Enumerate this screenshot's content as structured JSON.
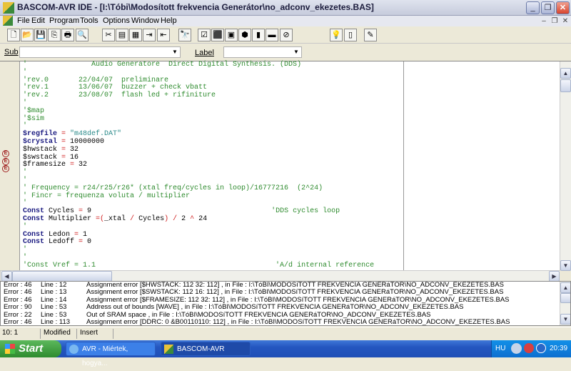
{
  "window": {
    "title": "BASCOM-AVR IDE - [I:\\Tóbi\\Modosított frekvencia Generátor\\no_adconv_ekezetes.BAS]",
    "minimize": "_",
    "restore": "❐",
    "close": "✕"
  },
  "menu": [
    "File",
    "Edit",
    "Program",
    "Tools",
    "Options",
    "Window",
    "Help"
  ],
  "mdi": {
    "minimize": "–",
    "restore": "❐",
    "close": "✕"
  },
  "toolbar": [
    {
      "name": "new-file",
      "glyph": "🗋"
    },
    {
      "name": "open-folder",
      "glyph": "📂"
    },
    {
      "name": "save",
      "glyph": "💾"
    },
    {
      "name": "save-as",
      "glyph": "⎘"
    },
    {
      "name": "print",
      "glyph": "🖶"
    },
    {
      "name": "print-preview",
      "glyph": "🔍"
    },
    {
      "name": "cut",
      "glyph": "✂"
    },
    {
      "name": "copy",
      "glyph": "▤"
    },
    {
      "name": "paste",
      "glyph": "▦"
    },
    {
      "name": "indent",
      "glyph": "⇥"
    },
    {
      "name": "unindent",
      "glyph": "⇤"
    },
    {
      "name": "find",
      "glyph": "🔭"
    },
    {
      "name": "syntax-check",
      "glyph": "☑"
    },
    {
      "name": "compile",
      "glyph": "⬛"
    },
    {
      "name": "report",
      "glyph": "▣"
    },
    {
      "name": "simulate",
      "glyph": "⬢"
    },
    {
      "name": "program-chip",
      "glyph": "▮"
    },
    {
      "name": "terminal",
      "glyph": "▬"
    },
    {
      "name": "stop",
      "glyph": "⊘"
    },
    {
      "name": "tip",
      "glyph": "💡"
    },
    {
      "name": "exit",
      "glyph": "▯"
    },
    {
      "name": "lib-manager",
      "glyph": "✎"
    }
  ],
  "subbar": {
    "sub_label": "Sub",
    "sub_value": "",
    "label_label": "Label",
    "label_value": ""
  },
  "code_lines": [
    [
      [
        "c",
        "'               Audio Generatore  Direct Digital Synthesis. (DDS)"
      ]
    ],
    [
      [
        "c",
        "'"
      ]
    ],
    [
      [
        "c",
        "'rev.0       22/04/07  preliminare"
      ]
    ],
    [
      [
        "c",
        "'rev.1       13/06/07  buzzer + check vbatt"
      ]
    ],
    [
      [
        "c",
        "'rev.2       23/08/07  flash led + rifiniture"
      ]
    ],
    [
      [
        "c",
        "'"
      ]
    ],
    [
      [
        "c",
        "'$map"
      ]
    ],
    [
      [
        "c",
        "'$sim"
      ]
    ],
    [
      [
        "c",
        "'"
      ]
    ],
    [
      [
        "k",
        "$regfile"
      ],
      [
        "o",
        " = "
      ],
      [
        "s",
        "\"m48def.DAT\""
      ]
    ],
    [
      [
        "k",
        "$crystal"
      ],
      [
        "o",
        " = "
      ],
      [
        "n",
        "10000000"
      ]
    ],
    [
      [
        "n",
        "$hwstack"
      ],
      [
        "o",
        " = "
      ],
      [
        "n",
        "32"
      ]
    ],
    [
      [
        "n",
        "$swstack"
      ],
      [
        "o",
        " = "
      ],
      [
        "n",
        "16"
      ]
    ],
    [
      [
        "n",
        "$framesize"
      ],
      [
        "o",
        " = "
      ],
      [
        "n",
        "32"
      ]
    ],
    [
      [
        "c",
        "'"
      ]
    ],
    [
      [
        "c",
        "'"
      ]
    ],
    [
      [
        "c",
        "' Frequency = r24/r25/r26* (xtal freq/cycles in loop)/16777216  (2^24)"
      ]
    ],
    [
      [
        "c",
        "' Fincr = frequenza voluta / multiplier"
      ]
    ],
    [
      [
        "c",
        "'"
      ]
    ],
    [
      [
        "k",
        "Const"
      ],
      [
        "n",
        " Cycles"
      ],
      [
        "o",
        " = "
      ],
      [
        "n",
        "9                                          "
      ],
      [
        "c",
        "'DDS cycles loop"
      ]
    ],
    [
      [
        "k",
        "Const"
      ],
      [
        "n",
        " Multiplier "
      ],
      [
        "o",
        "=("
      ],
      [
        "n",
        "_xtal "
      ],
      [
        "o",
        "/"
      ],
      [
        "n",
        " Cycles"
      ],
      [
        "o",
        ") / "
      ],
      [
        "n",
        "2 "
      ],
      [
        "o",
        "^"
      ],
      [
        "n",
        " 24"
      ]
    ],
    [
      [
        "c",
        "'"
      ]
    ],
    [
      [
        "k",
        "Const"
      ],
      [
        "n",
        " Ledon"
      ],
      [
        "o",
        " = "
      ],
      [
        "n",
        "1"
      ]
    ],
    [
      [
        "k",
        "Const"
      ],
      [
        "n",
        " Ledoff"
      ],
      [
        "o",
        " = "
      ],
      [
        "n",
        "0"
      ]
    ],
    [
      [
        "c",
        "'"
      ]
    ],
    [
      [
        "c",
        "'"
      ]
    ],
    [
      [
        "c",
        "'Const Vref = 1.1                                          'A/d internal reference"
      ]
    ]
  ],
  "error_marks": [
    "E",
    "E",
    "E"
  ],
  "errors": [
    {
      "code": "Error : 46",
      "line": "Line :  12",
      "msg": "Assignment error [$HWSTACK: 112  32: 112]  , in File : I:\\TóBI\\MODOSíTOTT FREKVENCIA GENERáTOR\\NO_ADCONV_EKEZETES.BAS"
    },
    {
      "code": "Error : 46",
      "line": "Line :  13",
      "msg": "Assignment error [$SWSTACK: 112  16: 112]  , in File : I:\\TóBI\\MODOSíTOTT FREKVENCIA GENERáTOR\\NO_ADCONV_EKEZETES.BAS"
    },
    {
      "code": "Error : 46",
      "line": "Line :  14",
      "msg": "Assignment error [$FRAMESIZE: 112  32: 112]  , in File : I:\\TóBI\\MODOSíTOTT FREKVENCIA GENERáTOR\\NO_ADCONV_EKEZETES.BAS"
    },
    {
      "code": "Error : 90",
      "line": "Line :  53",
      "msg": "Address out of bounds [WAVE]  , in File : I:\\TóBI\\MODOSíTOTT FREKVENCIA GENERáTOR\\NO_ADCONV_EKEZETES.BAS"
    },
    {
      "code": "Error : 22",
      "line": "Line :  53",
      "msg": "Out of SRAM space  , in File : I:\\TóBI\\MODOSíTOTT FREKVENCIA GENERáTOR\\NO_ADCONV_EKEZETES.BAS"
    },
    {
      "code": "Error : 46",
      "line": "Line : 113",
      "msg": "Assignment error [DDRC: 0  &B00110110: 112]  , in File : I:\\TóBI\\MODOSíTOTT FREKVENCIA GENERáTOR\\NO_ADCONV_EKEZETES.BAS"
    }
  ],
  "status": {
    "position": "10: 1",
    "modified": "Modified",
    "mode": "Insert"
  },
  "taskbar": {
    "start": "Start",
    "tasks": [
      "AVR - Miértek, hogya...",
      "BASCOM-AVR"
    ],
    "language": "HU",
    "clock": "20:39"
  }
}
